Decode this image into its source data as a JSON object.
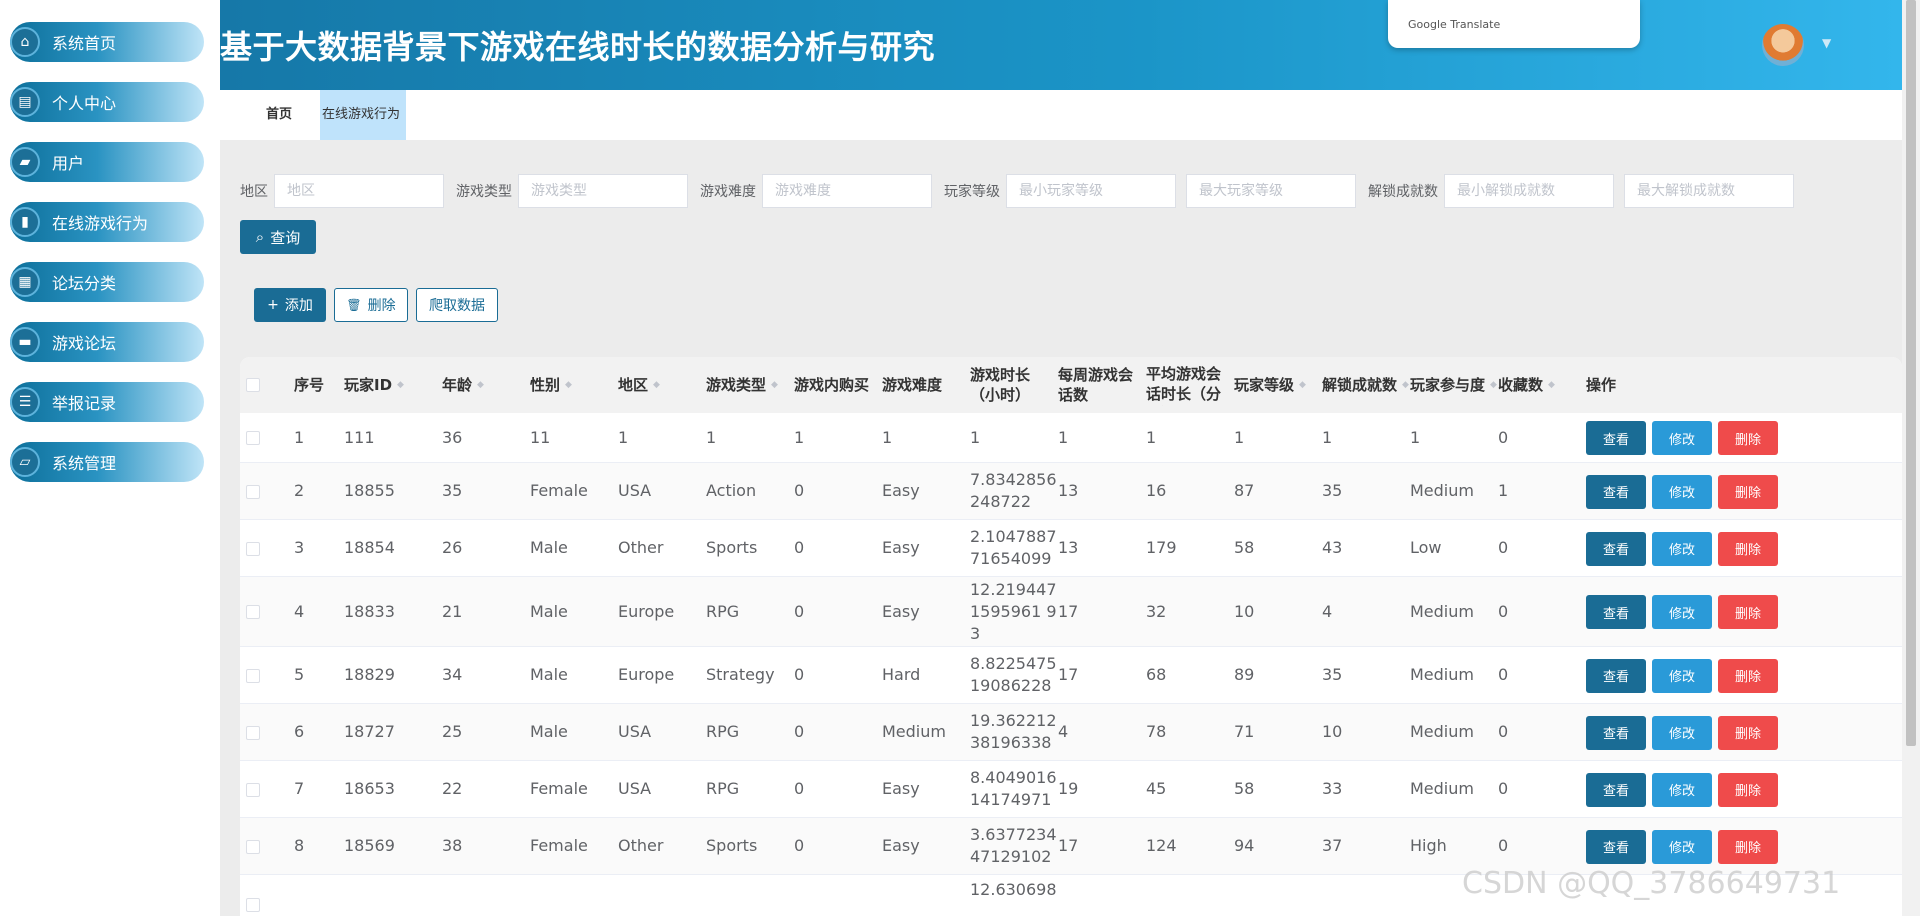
{
  "sidebar": {
    "items": [
      {
        "label": "系统首页",
        "icon": "home-icon",
        "glyph": "⌂"
      },
      {
        "label": "个人中心",
        "icon": "card-icon",
        "glyph": "▤"
      },
      {
        "label": "用户",
        "icon": "briefcase-icon",
        "glyph": "▰"
      },
      {
        "label": "在线游戏行为",
        "icon": "clipboard-icon",
        "glyph": "▮"
      },
      {
        "label": "论坛分类",
        "icon": "grid-icon",
        "glyph": "▦"
      },
      {
        "label": "游戏论坛",
        "icon": "ticket-icon",
        "glyph": "▬"
      },
      {
        "label": "举报记录",
        "icon": "sliders-icon",
        "glyph": "☰"
      },
      {
        "label": "系统管理",
        "icon": "folder-icon",
        "glyph": "▱"
      }
    ]
  },
  "header": {
    "title": "基于大数据背景下游戏在线时长的数据分析与研究",
    "translate_popup": "Google Translate"
  },
  "tabs": {
    "home": "首页",
    "active": "在线游戏行为"
  },
  "filters": {
    "region_label": "地区",
    "region_placeholder": "地区",
    "genre_label": "游戏类型",
    "genre_placeholder": "游戏类型",
    "difficulty_label": "游戏难度",
    "difficulty_placeholder": "游戏难度",
    "level_label": "玩家等级",
    "level_min_placeholder": "最小玩家等级",
    "level_max_placeholder": "最大玩家等级",
    "achievements_label": "解锁成就数",
    "achievements_min_placeholder": "最小解锁成就数",
    "achievements_max_placeholder": "最大解锁成就数",
    "query_button": "查询"
  },
  "actions": {
    "add": "添加",
    "delete": "删除",
    "crawl": "爬取数据"
  },
  "table": {
    "headers": {
      "index": "序号",
      "player_id": "玩家ID",
      "age": "年龄",
      "gender": "性别",
      "region": "地区",
      "genre": "游戏类型",
      "purchases": "游戏内购买",
      "difficulty": "游戏难度",
      "playtime": "游戏时长（小时）",
      "sessions": "每周游戏会话数",
      "avg_session": "平均游戏会话时长（分钟）",
      "level": "玩家等级",
      "achievements": "解锁成就数",
      "engagement": "玩家参与度",
      "favorites": "收藏数",
      "ops": "操作"
    },
    "row_buttons": {
      "view": "查看",
      "edit": "修改",
      "delete": "删除"
    },
    "rows": [
      {
        "index": "1",
        "player_id": "111",
        "age": "36",
        "gender": "11",
        "region": "1",
        "genre": "1",
        "purchases": "1",
        "difficulty": "1",
        "playtime": "1",
        "sessions": "1",
        "avg_session": "1",
        "level": "1",
        "achievements": "1",
        "engagement": "1",
        "favorites": "0"
      },
      {
        "index": "2",
        "player_id": "18855",
        "age": "35",
        "gender": "Female",
        "region": "USA",
        "genre": "Action",
        "purchases": "0",
        "difficulty": "Easy",
        "playtime": "7.8342856248722",
        "sessions": "13",
        "avg_session": "16",
        "level": "87",
        "achievements": "35",
        "engagement": "Medium",
        "favorites": "1"
      },
      {
        "index": "3",
        "player_id": "18854",
        "age": "26",
        "gender": "Male",
        "region": "Other",
        "genre": "Sports",
        "purchases": "0",
        "difficulty": "Easy",
        "playtime": "2.104788771654099",
        "sessions": "13",
        "avg_session": "179",
        "level": "58",
        "achievements": "43",
        "engagement": "Low",
        "favorites": "0"
      },
      {
        "index": "4",
        "player_id": "18833",
        "age": "21",
        "gender": "Male",
        "region": "Europe",
        "genre": "RPG",
        "purchases": "0",
        "difficulty": "Easy",
        "playtime": "12.2194471595961 93",
        "sessions": "17",
        "avg_session": "32",
        "level": "10",
        "achievements": "4",
        "engagement": "Medium",
        "favorites": "0"
      },
      {
        "index": "5",
        "player_id": "18829",
        "age": "34",
        "gender": "Male",
        "region": "Europe",
        "genre": "Strategy",
        "purchases": "0",
        "difficulty": "Hard",
        "playtime": "8.822547519086228",
        "sessions": "17",
        "avg_session": "68",
        "level": "89",
        "achievements": "35",
        "engagement": "Medium",
        "favorites": "0"
      },
      {
        "index": "6",
        "player_id": "18727",
        "age": "25",
        "gender": "Male",
        "region": "USA",
        "genre": "RPG",
        "purchases": "0",
        "difficulty": "Medium",
        "playtime": "19.36221238196338",
        "sessions": "4",
        "avg_session": "78",
        "level": "71",
        "achievements": "10",
        "engagement": "Medium",
        "favorites": "0"
      },
      {
        "index": "7",
        "player_id": "18653",
        "age": "22",
        "gender": "Female",
        "region": "USA",
        "genre": "RPG",
        "purchases": "0",
        "difficulty": "Easy",
        "playtime": "8.404901614174971",
        "sessions": "19",
        "avg_session": "45",
        "level": "58",
        "achievements": "33",
        "engagement": "Medium",
        "favorites": "0"
      },
      {
        "index": "8",
        "player_id": "18569",
        "age": "38",
        "gender": "Female",
        "region": "Other",
        "genre": "Sports",
        "purchases": "0",
        "difficulty": "Easy",
        "playtime": "3.637723447129102",
        "sessions": "17",
        "avg_session": "124",
        "level": "94",
        "achievements": "37",
        "engagement": "High",
        "favorites": "0"
      },
      {
        "index": "",
        "player_id": "",
        "age": "",
        "gender": "",
        "region": "",
        "genre": "",
        "purchases": "",
        "difficulty": "",
        "playtime": "12.630698",
        "sessions": "",
        "avg_session": "",
        "level": "",
        "achievements": "",
        "engagement": "",
        "favorites": ""
      }
    ]
  },
  "watermark": "CSDN @QQ_3786649731",
  "colors": {
    "primary": "#1a6c95",
    "edit": "#2a9ad8",
    "danger": "#ef4b4b",
    "header_start": "#1678a8",
    "header_end": "#33b6ec"
  }
}
